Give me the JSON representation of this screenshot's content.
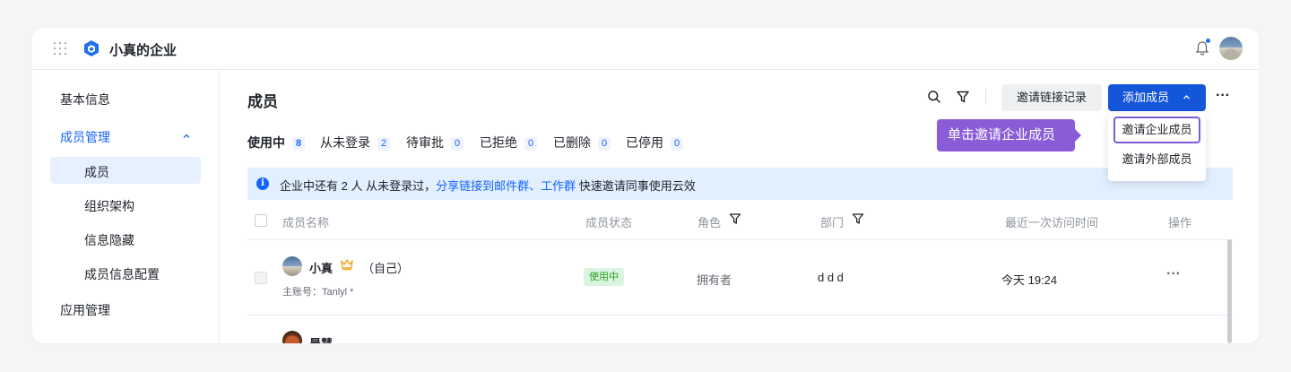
{
  "header": {
    "org_name": "小真的企业",
    "icons": [
      "apps-grid-icon",
      "org-logo-icon",
      "bell-icon",
      "user-avatar"
    ],
    "accent": "#1664ff"
  },
  "sidebar": {
    "items": [
      {
        "label": "基本信息"
      },
      {
        "label": "成员管理",
        "expanded": true
      },
      {
        "label": "成员",
        "selected": true
      },
      {
        "label": "组织架构"
      },
      {
        "label": "信息隐藏"
      },
      {
        "label": "成员信息配置"
      },
      {
        "label": "应用管理"
      }
    ]
  },
  "main": {
    "title": "成员",
    "invite_log_label": "邀请链接记录",
    "add_member_label": "添加成员",
    "more_label": "···",
    "tabs": [
      {
        "label": "使用中",
        "count": "8",
        "active": true
      },
      {
        "label": "从未登录",
        "count": "2"
      },
      {
        "label": "待审批",
        "count": "0"
      },
      {
        "label": "已拒绝",
        "count": "0"
      },
      {
        "label": "已删除",
        "count": "0"
      },
      {
        "label": "已停用",
        "count": "0"
      }
    ],
    "banner": {
      "prefix": "企业中还有 2 人 从未登录过，",
      "link": "分享链接到邮件群、工作群",
      "suffix": " 快速邀请同事使用云效"
    },
    "columns": [
      "成员名称",
      "成员状态",
      "角色",
      "部门",
      "最近一次访问时间",
      "操作"
    ],
    "rows": [
      {
        "name": "小真",
        "self_tag": "（自己）",
        "sub": "主账号：Tanlyl *",
        "status": "使用中",
        "role": "拥有者",
        "dept": "d d d",
        "last_visit": "今天 19:24",
        "action": "···"
      },
      {
        "name": "晨慧"
      }
    ]
  },
  "dropdown": {
    "items": [
      "邀请企业成员",
      "邀请外部成员"
    ]
  },
  "tooltip": {
    "text": "单击邀请企业成员",
    "color": "#8a5cd8"
  }
}
